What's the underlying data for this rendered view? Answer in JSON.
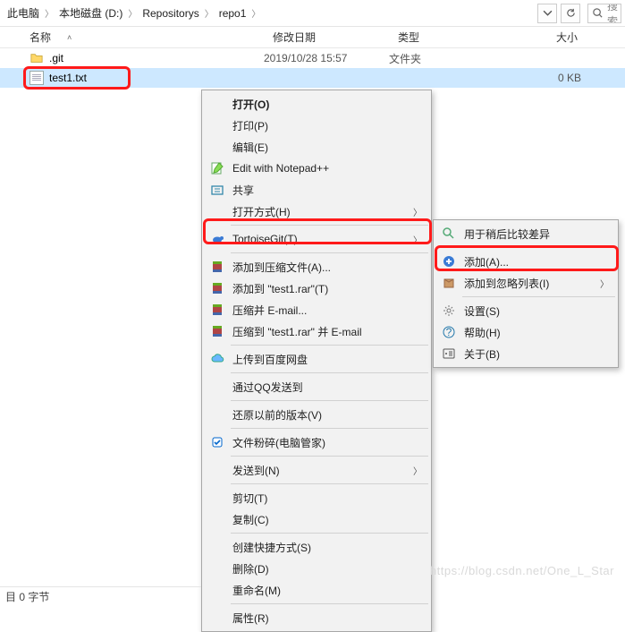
{
  "breadcrumbs": [
    "此电脑",
    "本地磁盘 (D:)",
    "Repositorys",
    "repo1"
  ],
  "search_placeholder": "搜索",
  "columns": {
    "name": "名称",
    "date": "修改日期",
    "type": "类型",
    "size": "大小"
  },
  "rows": [
    {
      "icon": "folder",
      "name": ".git",
      "date": "2019/10/28 15:57",
      "type": "文件夹",
      "size": ""
    },
    {
      "icon": "txt",
      "name": "test1.txt",
      "date": "",
      "type": "",
      "size": "0 KB",
      "selected": true
    }
  ],
  "menu1": [
    {
      "t": "item",
      "label": "打开(O)",
      "bold": true
    },
    {
      "t": "item",
      "label": "打印(P)"
    },
    {
      "t": "item",
      "label": "编辑(E)"
    },
    {
      "t": "item",
      "label": "Edit with Notepad++",
      "icon": "notepad"
    },
    {
      "t": "item",
      "label": "共享",
      "icon": "share"
    },
    {
      "t": "item",
      "label": "打开方式(H)",
      "sub": true
    },
    {
      "t": "sep"
    },
    {
      "t": "item",
      "label": "TortoiseGit(T)",
      "icon": "tortoise",
      "sub": true,
      "hl": true
    },
    {
      "t": "sep"
    },
    {
      "t": "item",
      "label": "添加到压缩文件(A)...",
      "icon": "rar"
    },
    {
      "t": "item",
      "label": "添加到 \"test1.rar\"(T)",
      "icon": "rar"
    },
    {
      "t": "item",
      "label": "压缩并 E-mail...",
      "icon": "rar"
    },
    {
      "t": "item",
      "label": "压缩到 \"test1.rar\" 并 E-mail",
      "icon": "rar"
    },
    {
      "t": "sep"
    },
    {
      "t": "item",
      "label": "上传到百度网盘",
      "icon": "cloud"
    },
    {
      "t": "sep"
    },
    {
      "t": "item",
      "label": "通过QQ发送到"
    },
    {
      "t": "sep"
    },
    {
      "t": "item",
      "label": "还原以前的版本(V)"
    },
    {
      "t": "sep"
    },
    {
      "t": "item",
      "label": "文件粉碎(电脑管家)",
      "icon": "shred"
    },
    {
      "t": "sep"
    },
    {
      "t": "item",
      "label": "发送到(N)",
      "sub": true
    },
    {
      "t": "sep"
    },
    {
      "t": "item",
      "label": "剪切(T)"
    },
    {
      "t": "item",
      "label": "复制(C)"
    },
    {
      "t": "sep"
    },
    {
      "t": "item",
      "label": "创建快捷方式(S)"
    },
    {
      "t": "item",
      "label": "删除(D)"
    },
    {
      "t": "item",
      "label": "重命名(M)"
    },
    {
      "t": "sep"
    },
    {
      "t": "item",
      "label": "属性(R)"
    }
  ],
  "menu2": [
    {
      "t": "item",
      "label": "用于稍后比较差异",
      "icon": "diff"
    },
    {
      "t": "sep"
    },
    {
      "t": "item",
      "label": "添加(A)...",
      "icon": "add",
      "hl": true
    },
    {
      "t": "item",
      "label": "添加到忽略列表(I)",
      "icon": "ignore",
      "sub": true
    },
    {
      "t": "sep"
    },
    {
      "t": "item",
      "label": "设置(S)",
      "icon": "settings"
    },
    {
      "t": "item",
      "label": "帮助(H)",
      "icon": "help"
    },
    {
      "t": "item",
      "label": "关于(B)",
      "icon": "about"
    }
  ],
  "status": "目 0 字节",
  "watermark": "https://blog.csdn.net/One_L_Star"
}
